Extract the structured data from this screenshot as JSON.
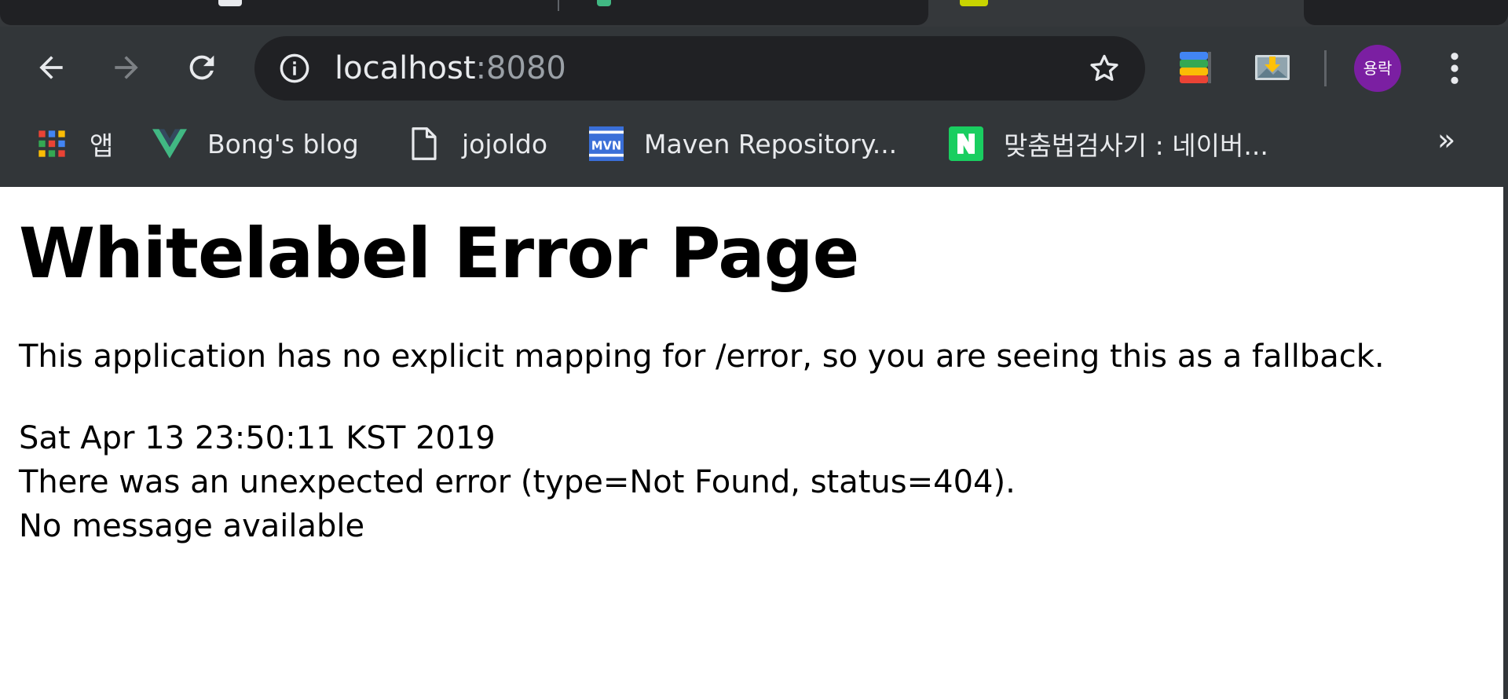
{
  "browser": {
    "omnibox": {
      "host": "localhost",
      "port": ":8080"
    },
    "profile": {
      "avatar_text": "용락",
      "avatar_color": "#7b1fa2"
    },
    "bookmarks": [
      {
        "label": "앱",
        "icon": "apps-grid-icon"
      },
      {
        "label": "Bong's blog",
        "icon": "vue-logo-icon"
      },
      {
        "label": "jojoldo",
        "icon": "page-icon"
      },
      {
        "label": "Maven Repository...",
        "icon": "mvn-logo-icon"
      },
      {
        "label": "맞춤법검사기 : 네이버...",
        "icon": "naver-logo-icon"
      }
    ],
    "bookmarks_overflow": "»"
  },
  "page": {
    "title": "Whitelabel Error Page",
    "intro": "This application has no explicit mapping for /error, so you are seeing this as a fallback.",
    "timestamp": "Sat Apr 13 23:50:11 KST 2019",
    "error_line": "There was an unexpected error (type=Not Found, status=404).",
    "message": "No message available"
  },
  "colors": {
    "chrome_bg": "#323639",
    "omnibox_bg": "#202124",
    "text_light": "#e8eaed",
    "naver_green": "#19ce60",
    "vue_green": "#41b883"
  }
}
